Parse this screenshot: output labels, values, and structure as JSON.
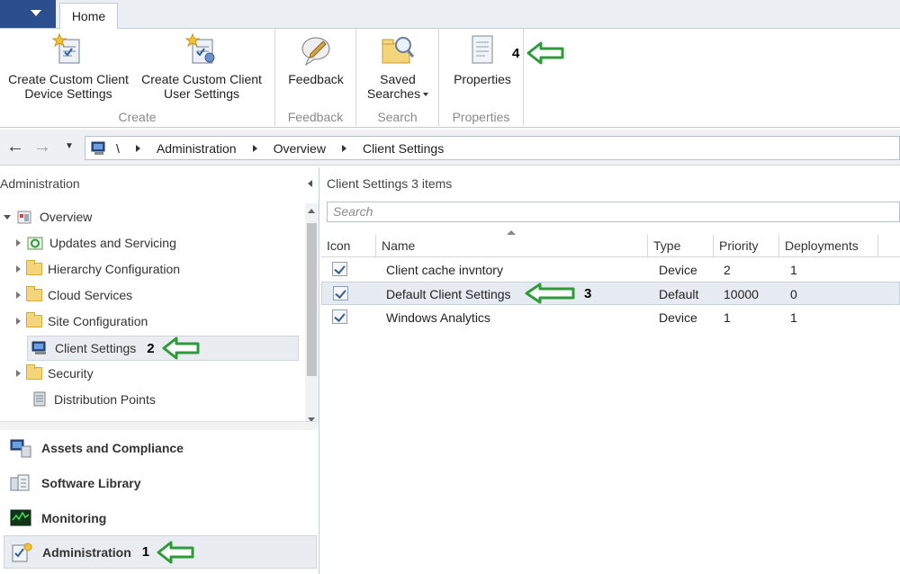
{
  "ribbon": {
    "tab_home": "Home",
    "groups": {
      "create": "Create",
      "feedback": "Feedback",
      "search": "Search",
      "properties": "Properties"
    },
    "buttons": {
      "create_device_l1": "Create Custom Client",
      "create_device_l2": "Device Settings",
      "create_user_l1": "Create Custom Client",
      "create_user_l2": "User Settings",
      "feedback": "Feedback",
      "saved_l1": "Saved",
      "saved_l2": "Searches",
      "properties": "Properties"
    }
  },
  "callouts": {
    "one": "1",
    "two": "2",
    "three": "3",
    "four": "4"
  },
  "breadcrumb": {
    "root": "\\",
    "items": [
      "Administration",
      "Overview",
      "Client Settings"
    ]
  },
  "nav": {
    "title": "Administration",
    "tree": [
      {
        "label": "Overview"
      },
      {
        "label": "Updates and Servicing"
      },
      {
        "label": "Hierarchy Configuration"
      },
      {
        "label": "Cloud Services"
      },
      {
        "label": "Site Configuration"
      },
      {
        "label": "Client Settings"
      },
      {
        "label": "Security"
      },
      {
        "label": "Distribution Points"
      }
    ],
    "workspaces": [
      {
        "label": "Assets and Compliance"
      },
      {
        "label": "Software Library"
      },
      {
        "label": "Monitoring"
      },
      {
        "label": "Administration"
      }
    ]
  },
  "list": {
    "title": "Client Settings 3 items",
    "search_placeholder": "Search",
    "columns": [
      "Icon",
      "Name",
      "Type",
      "Priority",
      "Deployments"
    ],
    "rows": [
      {
        "name": "Client cache invntory",
        "type": "Device",
        "priority": "2",
        "deployments": "1"
      },
      {
        "name": "Default Client Settings",
        "type": "Default",
        "priority": "10000",
        "deployments": "0"
      },
      {
        "name": "Windows Analytics",
        "type": "Device",
        "priority": "1",
        "deployments": "1"
      }
    ]
  },
  "colors": {
    "accent": "#2b4f8c",
    "callout_arrow": "#2e9a3a"
  }
}
